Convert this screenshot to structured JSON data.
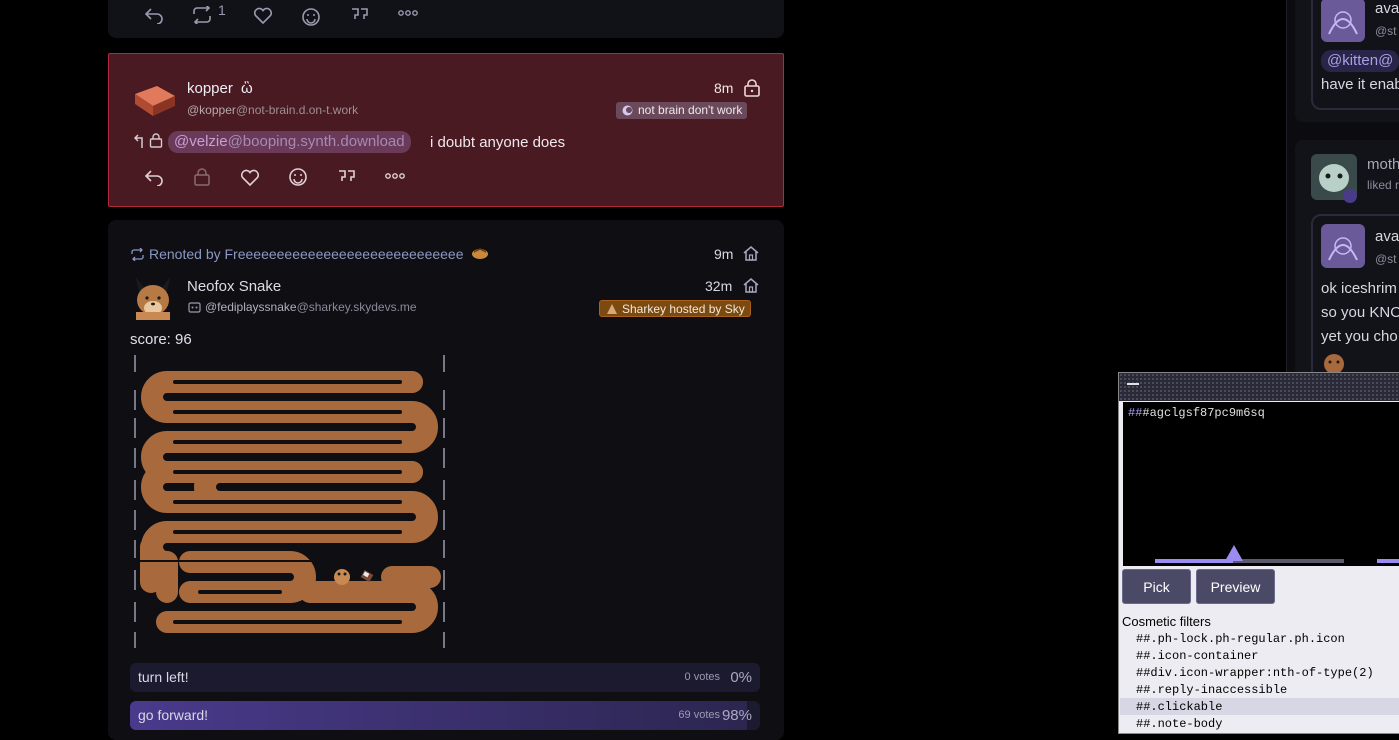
{
  "top_note": {
    "renote_count": "1"
  },
  "highlighted_note": {
    "author_name": "kopper",
    "author_emoji": "ὢ",
    "username": "@kopper",
    "host": "@not-brain.d.on-t.work",
    "time": "8m",
    "instance": "not brain don't work",
    "mention_user": "@velzie",
    "mention_host": "@booping.synth.download",
    "text": "i doubt anyone does"
  },
  "snake_note": {
    "renoted_by": "Renoted by Freeeeeeeeeeeeeeeeeeeeeeeeeeeee",
    "renote_time": "9m",
    "author_name": "Neofox Snake",
    "username": "@fediplayssnake",
    "host": "@sharkey.skydevs.me",
    "time": "32m",
    "instance": "Sharkey hosted by Sky",
    "score": "score: 96",
    "poll": [
      {
        "label": "turn left!",
        "votes": "0 votes",
        "pct": "0%",
        "fraction": 0.0
      },
      {
        "label": "go forward!",
        "votes": "69 votes",
        "pct": "98%",
        "fraction": 0.98
      }
    ]
  },
  "right_column": {
    "card1_name": "ava",
    "card1_handle": "@st",
    "card1_mention": "@kitten@",
    "card1_text": "have it enab",
    "card2_name": "moth",
    "card2_sub": "liked r",
    "card2_quote_name": "ava",
    "card2_quote_handle": "@st",
    "card2_line1": "ok iceshrim",
    "card2_line2": "so you KNO",
    "card2_line3": "yet you cho"
  },
  "picker": {
    "filter_text_hash": "##",
    "filter_text": "#agclgsf87pc9m6sq",
    "pick_label": "Pick",
    "preview_label": "Preview",
    "section_title": "Cosmetic filters",
    "cosmetic_filters": [
      "##.ph-lock.ph-regular.ph.icon",
      "##.icon-container",
      "##div.icon-wrapper:nth-of-type(2)",
      "##.reply-inaccessible",
      "##.clickable",
      "##.note-body"
    ]
  },
  "colors": {
    "highlight_bg": "#4a1a22",
    "highlight_border": "#b02a3a",
    "accent": "#9a8cf0",
    "snake": "#a86a3c"
  }
}
